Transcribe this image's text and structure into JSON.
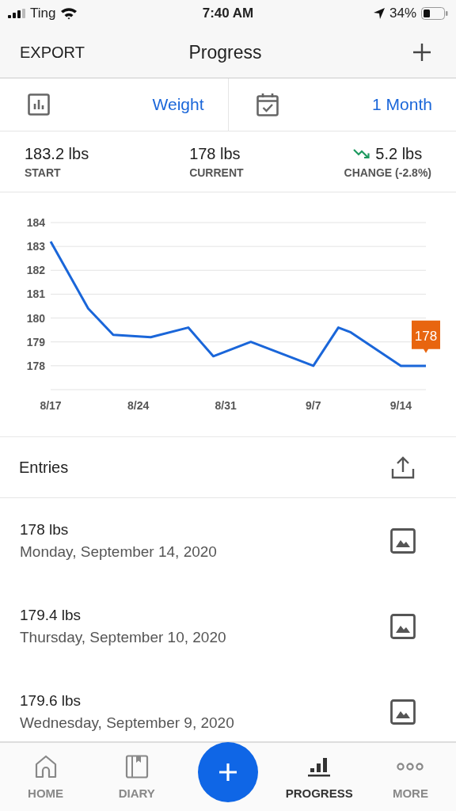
{
  "status_bar": {
    "carrier": "Ting",
    "time": "7:40 AM",
    "battery": "34%"
  },
  "nav": {
    "left": "EXPORT",
    "title": "Progress"
  },
  "selectors": [
    {
      "kind": "chart",
      "value": "Weight"
    },
    {
      "kind": "calendar",
      "value": "1 Month"
    }
  ],
  "stats": [
    {
      "kind": "plain",
      "value": "183.2 lbs",
      "label": "START"
    },
    {
      "kind": "plain",
      "value": "178 lbs",
      "label": "CURRENT"
    },
    {
      "kind": "decrease",
      "value": "5.2 lbs",
      "label": "CHANGE (-2.8%)"
    }
  ],
  "chart_data": {
    "type": "line",
    "categories": [
      "8/17",
      null,
      null,
      null,
      null,
      null,
      null,
      "8/24",
      null,
      null,
      null,
      null,
      null,
      null,
      "8/31",
      null,
      null,
      null,
      null,
      null,
      null,
      "9/7",
      null,
      null,
      null,
      null,
      null,
      null,
      "9/14",
      null,
      null
    ],
    "series": [
      {
        "color": "#1a66d9",
        "values": [
          183.2,
          null,
          null,
          180.4,
          null,
          179.3,
          null,
          null,
          179.2,
          null,
          null,
          179.6,
          null,
          178.4,
          null,
          null,
          179.0,
          null,
          null,
          null,
          null,
          178.0,
          null,
          179.6,
          179.4,
          null,
          null,
          null,
          178.0,
          null,
          178.0
        ]
      }
    ],
    "ylim": [
      177,
      184
    ],
    "yticks": [
      178,
      179,
      180,
      181,
      182,
      183,
      184
    ],
    "grid": true,
    "annotations": [
      {
        "y": 178,
        "text": "178"
      }
    ]
  },
  "entries_header": "Entries",
  "entries": [
    {
      "weight": "178 lbs",
      "date": "Monday, September 14, 2020"
    },
    {
      "weight": "179.4 lbs",
      "date": "Thursday, September 10, 2020"
    },
    {
      "weight": "179.6 lbs",
      "date": "Wednesday, September 9, 2020"
    }
  ],
  "tabs": [
    {
      "kind": "home",
      "label": "HOME",
      "selected": false
    },
    {
      "kind": "diary",
      "label": "DIARY",
      "selected": false
    },
    {
      "kind": "add"
    },
    {
      "kind": "progress",
      "label": "PROGRESS",
      "selected": true
    },
    {
      "kind": "more",
      "label": "MORE",
      "selected": false
    }
  ]
}
